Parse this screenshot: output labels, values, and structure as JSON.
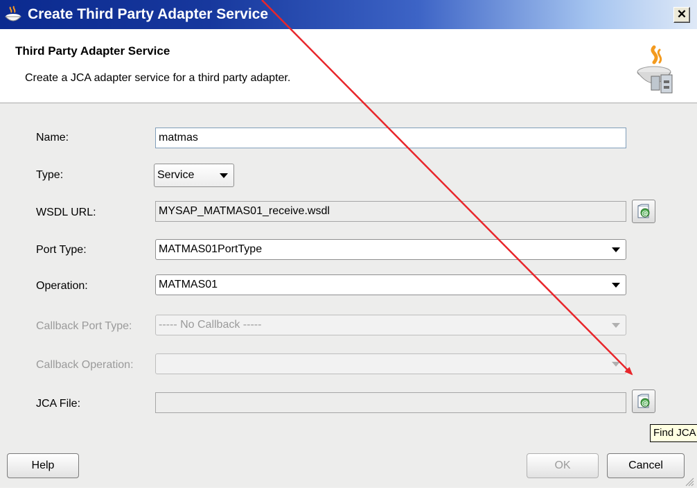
{
  "window": {
    "title": "Create Third Party Adapter Service",
    "close_label": "✕"
  },
  "header": {
    "title": "Third Party Adapter Service",
    "description": "Create a JCA adapter service for a third party adapter."
  },
  "form": {
    "name": {
      "label": "Name:",
      "value": "matmas"
    },
    "type": {
      "label": "Type:",
      "value": "Service"
    },
    "wsdl_url": {
      "label": "WSDL URL:",
      "value": "MYSAP_MATMAS01_receive.wsdl"
    },
    "port_type": {
      "label": "Port Type:",
      "value": "MATMAS01PortType"
    },
    "operation": {
      "label": "Operation:",
      "value": "MATMAS01"
    },
    "callback_port_type": {
      "label": "Callback Port Type:",
      "value": "----- No Callback -----"
    },
    "callback_operation": {
      "label": "Callback Operation:",
      "value": ""
    },
    "jca_file": {
      "label": "JCA File:",
      "value": ""
    }
  },
  "tooltip": {
    "text": "Find JCA"
  },
  "buttons": {
    "help": "Help",
    "ok": "OK",
    "cancel": "Cancel"
  },
  "colors": {
    "annotation_arrow": "#e8262b",
    "title_bar": "#17389d"
  },
  "icons": {
    "title": "coffee-cup-icon",
    "header": "adapter-service-icon",
    "browse": "browse-wsdl-icon"
  }
}
